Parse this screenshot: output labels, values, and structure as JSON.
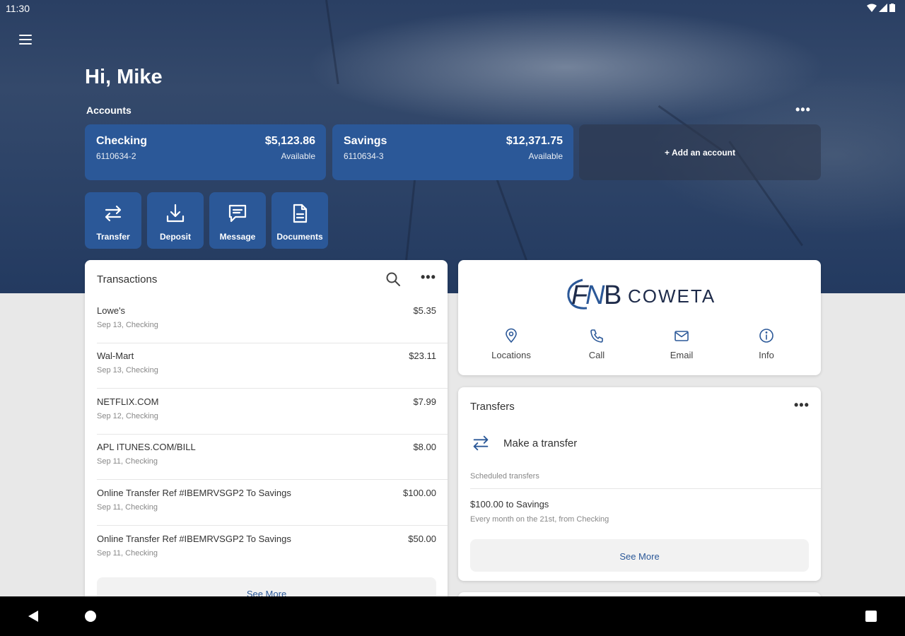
{
  "status_bar": {
    "time": "11:30"
  },
  "greeting": "Hi, Mike",
  "accounts": {
    "label": "Accounts",
    "more": "•••",
    "items": [
      {
        "name": "Checking",
        "number": "6110634-2",
        "amount": "$5,123.86",
        "status": "Available"
      },
      {
        "name": "Savings",
        "number": "6110634-3",
        "amount": "$12,371.75",
        "status": "Available"
      }
    ],
    "add_label": "+ Add an account"
  },
  "quick_actions": [
    {
      "label": "Transfer",
      "icon": "transfer-icon"
    },
    {
      "label": "Deposit",
      "icon": "deposit-icon"
    },
    {
      "label": "Message",
      "icon": "message-icon"
    },
    {
      "label": "Documents",
      "icon": "document-icon"
    }
  ],
  "transactions": {
    "title": "Transactions",
    "more": "•••",
    "items": [
      {
        "description": "Lowe's",
        "meta": "Sep 13, Checking",
        "amount": "$5.35"
      },
      {
        "description": "Wal-Mart",
        "meta": "Sep 13, Checking",
        "amount": "$23.11"
      },
      {
        "description": "NETFLIX.COM",
        "meta": "Sep 12, Checking",
        "amount": "$7.99"
      },
      {
        "description": "APL ITUNES.COM/BILL",
        "meta": "Sep 11, Checking",
        "amount": "$8.00"
      },
      {
        "description": "Online Transfer Ref #IBEMRVSGP2 To Savings",
        "meta": "Sep 11, Checking",
        "amount": "$100.00"
      },
      {
        "description": "Online Transfer Ref #IBEMRVSGP2 To Savings",
        "meta": "Sep 11, Checking",
        "amount": "$50.00"
      }
    ],
    "see_more": "See More"
  },
  "bank": {
    "logo_text": "FNB COWETA",
    "actions": [
      {
        "label": "Locations",
        "icon": "location-pin-icon"
      },
      {
        "label": "Call",
        "icon": "phone-icon"
      },
      {
        "label": "Email",
        "icon": "email-icon"
      },
      {
        "label": "Info",
        "icon": "info-icon"
      }
    ]
  },
  "transfers": {
    "title": "Transfers",
    "more": "•••",
    "make_label": "Make a transfer",
    "scheduled_label": "Scheduled transfers",
    "scheduled": [
      {
        "title": "$100.00 to Savings",
        "detail": "Every month on the 21st, from Checking"
      }
    ],
    "see_more": "See More"
  },
  "colors": {
    "primary": "#2b5898",
    "hero_dark": "#233a60",
    "background": "#e8e8e8",
    "card": "#ffffff"
  }
}
